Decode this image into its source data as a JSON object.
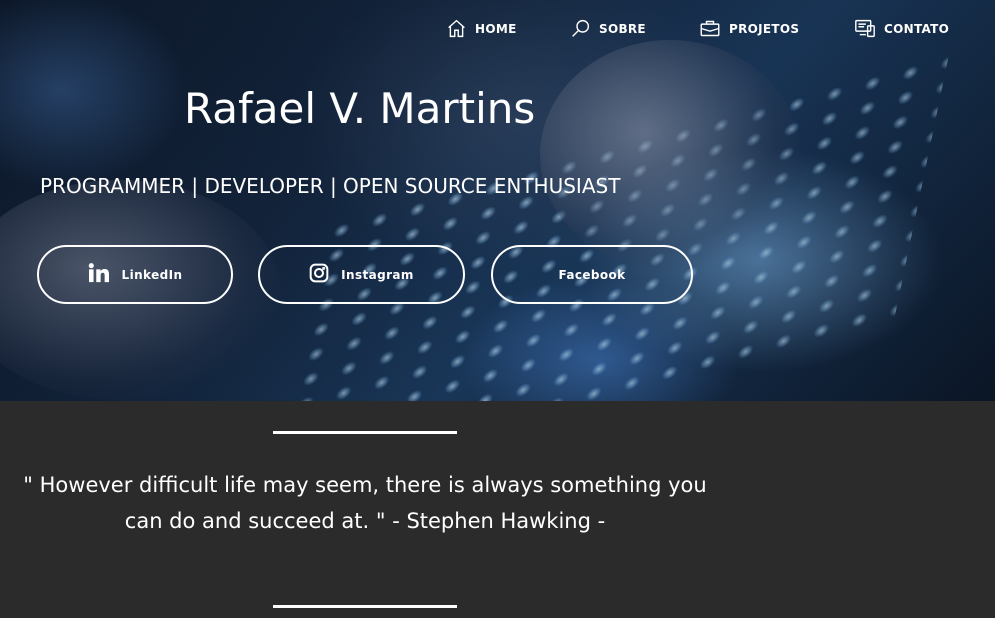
{
  "nav": {
    "items": [
      {
        "label": "HOME",
        "icon": "home-icon"
      },
      {
        "label": "SOBRE",
        "icon": "search-icon"
      },
      {
        "label": "PROJETOS",
        "icon": "briefcase-icon"
      },
      {
        "label": "CONTATO",
        "icon": "devices-icon"
      }
    ]
  },
  "hero": {
    "name": "Rafael V. Martins",
    "tagline": "PROGRAMMER | DEVELOPER | OPEN SOURCE ENTHUSIAST"
  },
  "social": [
    {
      "label": "LinkedIn",
      "icon": "linkedin-icon"
    },
    {
      "label": "Instagram",
      "icon": "instagram-icon"
    },
    {
      "label": "Facebook",
      "icon": "facebook-icon"
    }
  ],
  "quote": {
    "line1": "\" However difficult life may seem, there is always something you",
    "line2": "can do and succeed at. \" - Stephen Hawking -"
  },
  "colors": {
    "text": "#ffffff",
    "quote_background": "#2b2b2b",
    "hero_tint": "#14263f"
  }
}
